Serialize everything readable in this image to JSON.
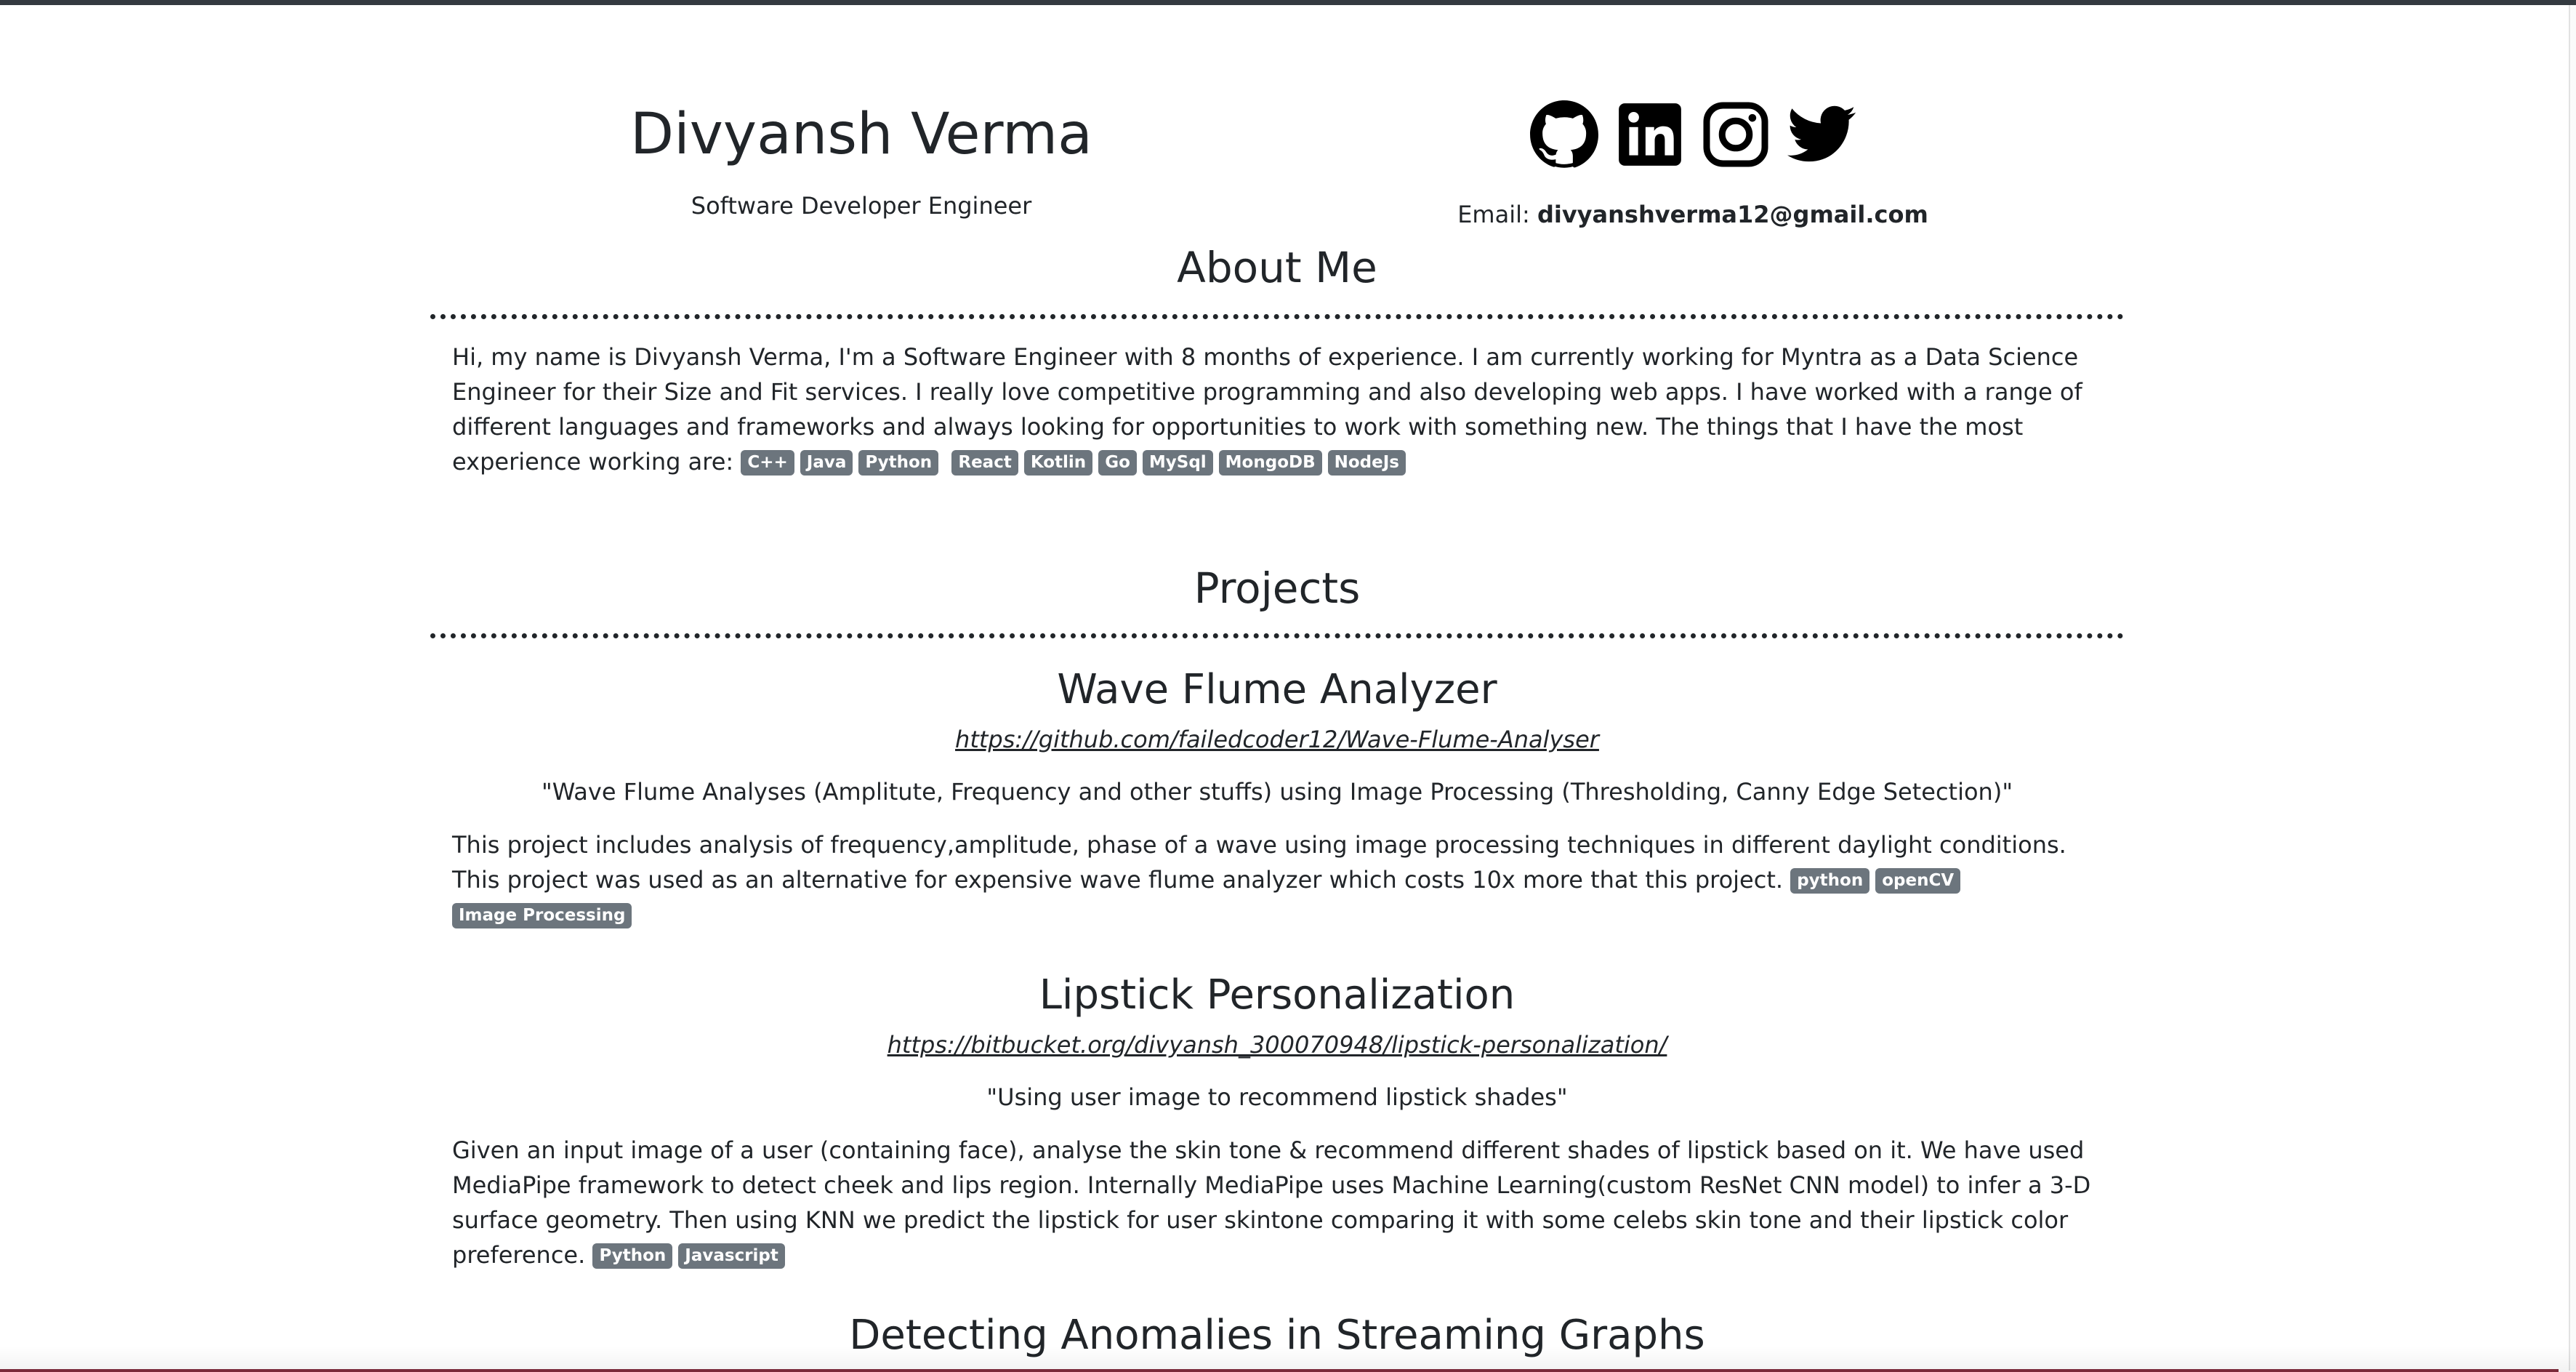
{
  "header": {
    "name": "Divyansh Verma",
    "role": "Software Developer Engineer",
    "email_label": "Email:",
    "email": "divyanshverma12@gmail.com",
    "social_icons": [
      "github-icon",
      "linkedin-icon",
      "instagram-icon",
      "twitter-icon"
    ]
  },
  "about": {
    "title": "About Me",
    "text": "Hi, my name is Divyansh Verma, I'm a Software Engineer with 8 months of experience. I am currently working for Myntra as a Data Science Engineer for their Size and Fit services. I really love competitive programming and also developing web apps. I have worked with a range of different languages and frameworks and always looking for opportunities to work with something new. The things that I have the most experience working are:",
    "skills": [
      "C++",
      "Java",
      "Python",
      "React",
      "Kotlin",
      "Go",
      "MySql",
      "MongoDB",
      "NodeJs"
    ]
  },
  "projects_title": "Projects",
  "projects": [
    {
      "title": "Wave Flume Analyzer",
      "link": "https://github.com/failedcoder12/Wave-Flume-Analyser",
      "quote": "\"Wave Flume Analyses (Amplitute, Frequency and other stuffs) using Image Processing (Thresholding, Canny Edge Setection)\"",
      "description": "This project includes analysis of frequency,amplitude, phase of a wave using image processing techniques in different daylight conditions. This project was used as an alternative for expensive wave flume analyzer which costs 10x more that this project.",
      "tags": [
        "python",
        "openCV",
        "Image Processing"
      ]
    },
    {
      "title": "Lipstick Personalization",
      "link": "https://bitbucket.org/divyansh_300070948/lipstick-personalization/",
      "quote": "\"Using user image to recommend lipstick shades\"",
      "description": "Given an input image of a user (containing face), analyse the skin tone & recommend different shades of lipstick based on it. We have used MediaPipe framework to detect cheek and lips region. Internally MediaPipe uses Machine Learning(custom ResNet CNN model) to infer a 3-D surface geometry. Then using KNN we predict the lipstick for user skintone comparing it with some celebs skin tone and their lipstick color preference.",
      "tags": [
        "Python",
        "Javascript"
      ]
    },
    {
      "title": "Detecting Anomalies in Streaming Graphs"
    }
  ],
  "colors": {
    "badge_bg": "#6c757d",
    "text": "#212529",
    "top_bar": "#343a40"
  }
}
